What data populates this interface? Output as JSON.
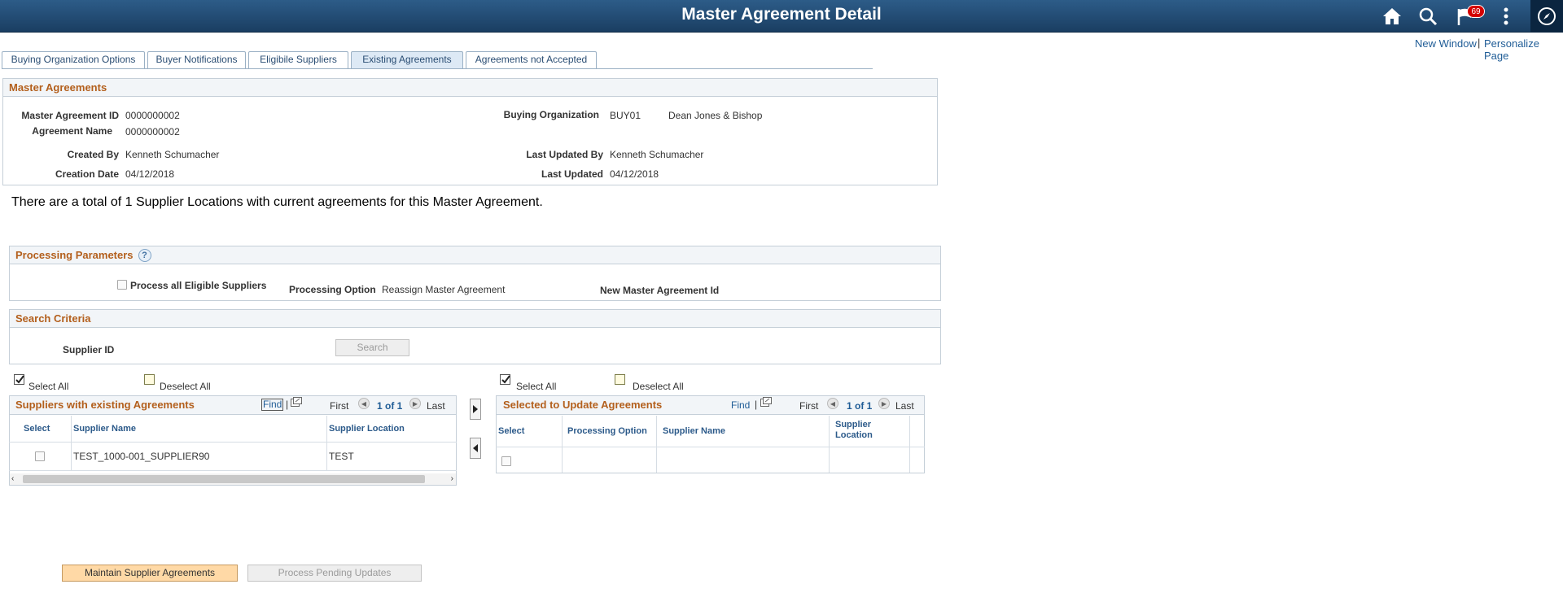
{
  "header": {
    "title": "Master Agreement Detail",
    "notification_count": "69",
    "icons": [
      "home-icon",
      "search-icon",
      "flag-icon",
      "more-icon",
      "navigator-icon"
    ]
  },
  "top_links": {
    "new_window": "New Window",
    "separator": "|",
    "personalize": "Personalize Page"
  },
  "tabs": [
    {
      "label": "Buying Organization Options"
    },
    {
      "label": "Buyer Notifications"
    },
    {
      "label": "Eligibile Suppliers"
    },
    {
      "label": "Existing Agreements",
      "active": true
    },
    {
      "label": "Agreements not Accepted"
    }
  ],
  "master_agreements": {
    "title": "Master Agreements",
    "id_label": "Master Agreement ID",
    "id_value": "0000000002",
    "name_label": "Agreement Name",
    "name_value": "0000000002",
    "created_by_label": "Created By",
    "created_by_value": "Kenneth Schumacher",
    "creation_date_label": "Creation Date",
    "creation_date_value": "04/12/2018",
    "buying_org_label": "Buying Organization",
    "buying_org_code": "BUY01",
    "buying_org_name": "Dean Jones & Bishop",
    "last_updated_by_label": "Last Updated By",
    "last_updated_by_value": "Kenneth Schumacher",
    "last_updated_label": "Last Updated",
    "last_updated_value": "04/12/2018"
  },
  "info_text": "There are a total of 1 Supplier Locations with current agreements for this Master Agreement.",
  "processing": {
    "title": "Processing Parameters",
    "help": "?",
    "process_all_label": "Process all Eligible Suppliers",
    "option_label": "Processing Option",
    "option_value": "Reassign Master Agreement",
    "new_id_label": "New Master Agreement Id"
  },
  "search": {
    "title": "Search Criteria",
    "supplier_id_label": "Supplier ID",
    "search_button": "Search"
  },
  "left_select": {
    "select_all": "Select All",
    "deselect_all": "Deselect All"
  },
  "right_select": {
    "select_all": "Select All",
    "deselect_all": "Deselect All"
  },
  "left_grid": {
    "title": "Suppliers with existing Agreements",
    "find": "Find",
    "sep": "|",
    "first": "First",
    "count": "1 of 1",
    "last": "Last",
    "columns": [
      "Select",
      "Supplier Name",
      "Supplier Location"
    ],
    "rows": [
      {
        "supplier_name": "TEST_1000-001_SUPPLIER90",
        "supplier_location": "TEST"
      }
    ]
  },
  "right_grid": {
    "title": "Selected to Update Agreements",
    "find": "Find",
    "sep": "|",
    "first": "First",
    "count": "1 of 1",
    "last": "Last",
    "columns": [
      "Select",
      "Processing Option",
      "Supplier Name",
      "Supplier\nLocation"
    ]
  },
  "buttons": {
    "maintain": "Maintain Supplier Agreements",
    "process_pending": "Process Pending Updates"
  }
}
